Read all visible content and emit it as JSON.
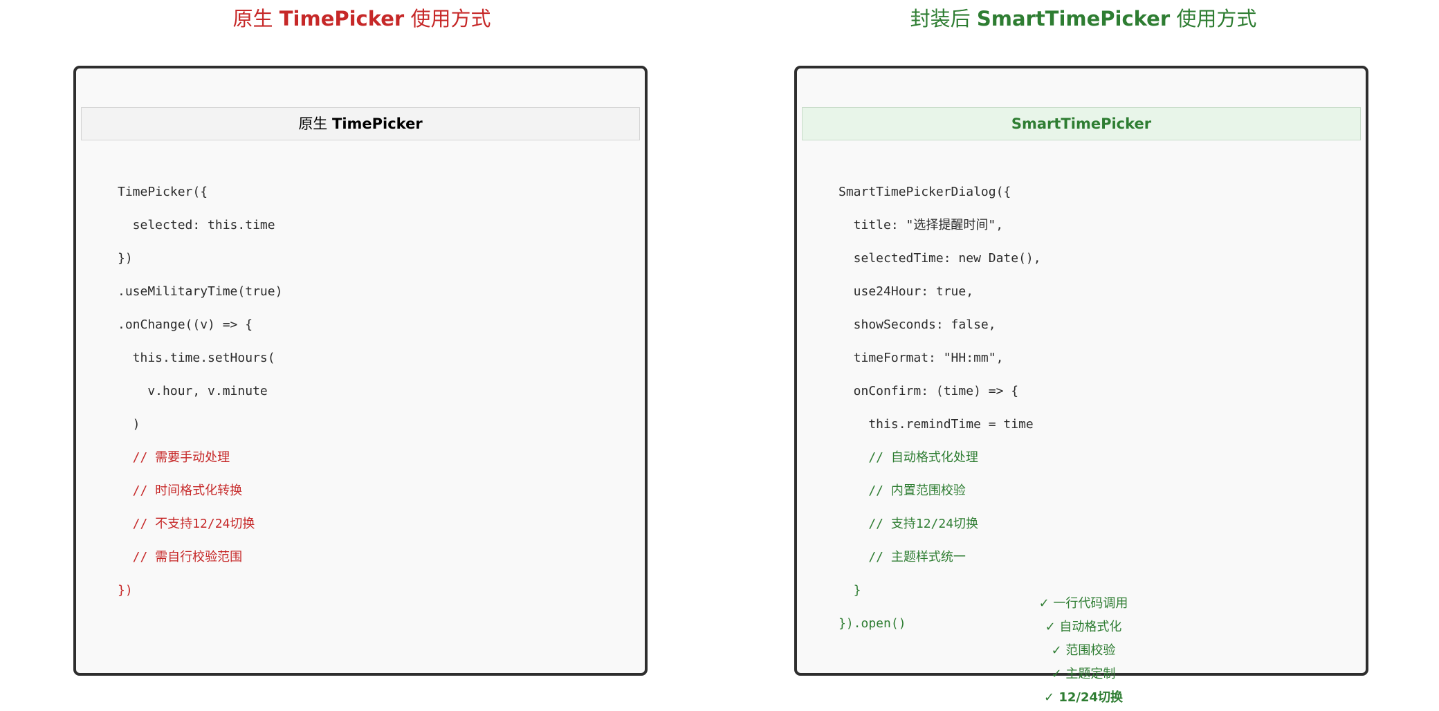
{
  "left": {
    "title_prefix": "原生 ",
    "title_strong": "TimePicker",
    "title_suffix": " 使用方式",
    "header_prefix": "原生 ",
    "header_strong": "TimePicker",
    "code_lines": [
      {
        "text": "TimePicker({",
        "style": "normal"
      },
      {
        "text": "  selected: this.time",
        "style": "normal"
      },
      {
        "text": "})",
        "style": "normal"
      },
      {
        "text": ".useMilitaryTime(true)",
        "style": "normal"
      },
      {
        "text": ".onChange((v) => {",
        "style": "normal"
      },
      {
        "text": "  this.time.setHours(",
        "style": "normal"
      },
      {
        "text": "    v.hour, v.minute",
        "style": "normal"
      },
      {
        "text": "  )",
        "style": "normal"
      },
      {
        "text": "  // 需要手动处理",
        "style": "red"
      },
      {
        "text": "  // 时间格式化转换",
        "style": "red"
      },
      {
        "text": "  // 不支持12/24切换",
        "style": "red"
      },
      {
        "text": "  // 需自行校验范围",
        "style": "red"
      },
      {
        "text": "})",
        "style": "red"
      }
    ]
  },
  "right": {
    "title_prefix": "封装后 ",
    "title_strong": "SmartTimePicker",
    "title_suffix": " 使用方式",
    "header": "SmartTimePicker",
    "code_lines": [
      {
        "text": "SmartTimePickerDialog({",
        "style": "normal"
      },
      {
        "text": "  title: \"选择提醒时间\",",
        "style": "normal"
      },
      {
        "text": "  selectedTime: new Date(),",
        "style": "normal"
      },
      {
        "text": "  use24Hour: true,",
        "style": "normal"
      },
      {
        "text": "  showSeconds: false,",
        "style": "normal"
      },
      {
        "text": "  timeFormat: \"HH:mm\",",
        "style": "normal"
      },
      {
        "text": "  onConfirm: (time) => {",
        "style": "normal"
      },
      {
        "text": "    this.remindTime = time",
        "style": "normal"
      },
      {
        "text": "    // 自动格式化处理",
        "style": "green"
      },
      {
        "text": "    // 内置范围校验",
        "style": "green"
      },
      {
        "text": "    // 支持12/24切换",
        "style": "green"
      },
      {
        "text": "    // 主题样式统一",
        "style": "green"
      },
      {
        "text": "  }",
        "style": "green"
      },
      {
        "text": "}).open()",
        "style": "green"
      }
    ],
    "features": [
      {
        "text": "✓ 一行代码调用",
        "bold": false
      },
      {
        "text": "✓ 自动格式化",
        "bold": false
      },
      {
        "text": "✓ 范围校验",
        "bold": false
      },
      {
        "text": "✓ 主题定制",
        "bold": false
      },
      {
        "text": "✓ 12/24切换",
        "bold": false
      }
    ]
  },
  "colors": {
    "native_accent": "#c62828",
    "smart_accent": "#2e7d32",
    "panel_border": "#2e2e2e"
  }
}
